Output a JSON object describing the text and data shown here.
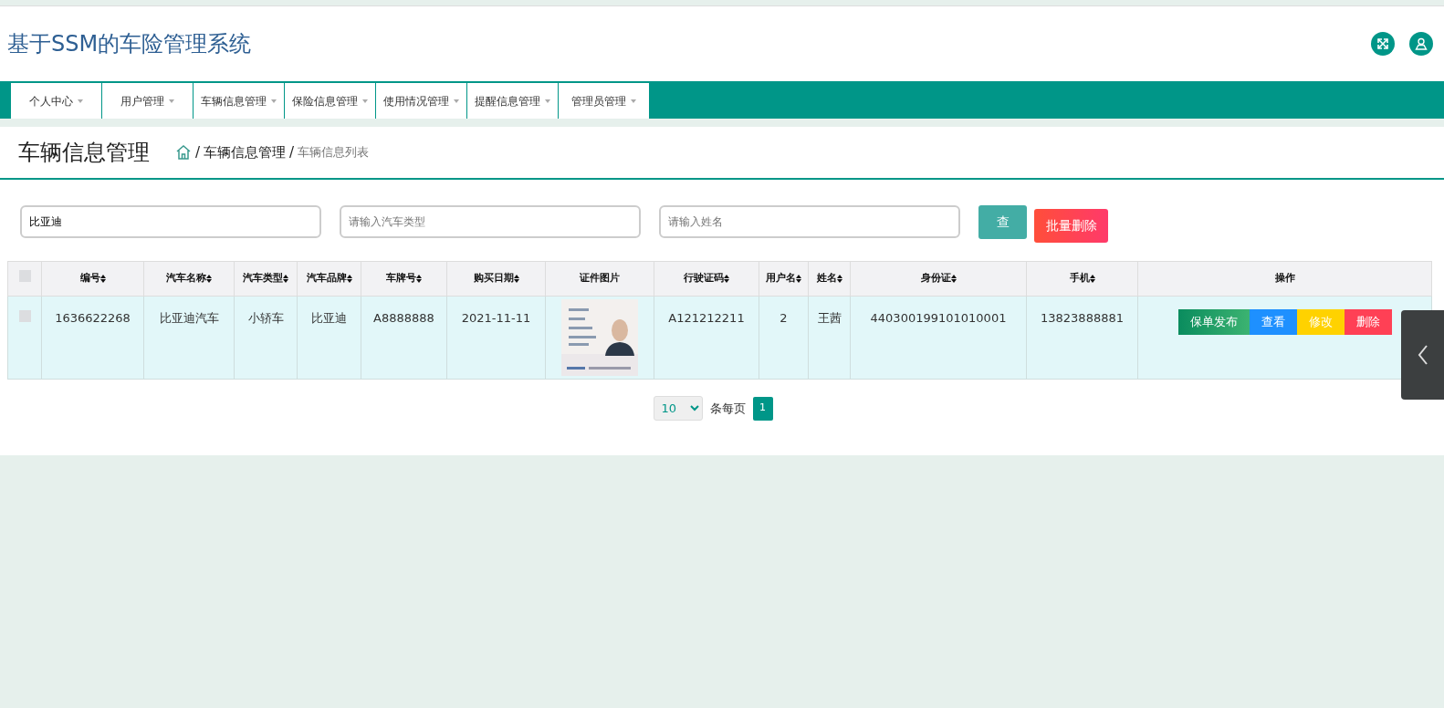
{
  "header": {
    "title": "基于SSM的车险管理系统"
  },
  "nav": [
    {
      "label": "个人中心",
      "dropdown": true
    },
    {
      "label": "用户管理",
      "dropdown": true
    },
    {
      "label": "车辆信息管理",
      "dropdown": true
    },
    {
      "label": "保险信息管理",
      "dropdown": true
    },
    {
      "label": "使用情况管理",
      "dropdown": true
    },
    {
      "label": "提醒信息管理",
      "dropdown": true
    },
    {
      "label": "管理员管理",
      "dropdown": true
    }
  ],
  "page": {
    "title": "车辆信息管理",
    "breadcrumb": [
      {
        "separator": "/",
        "label": "车辆信息管理",
        "current": false
      },
      {
        "separator": "/",
        "label": "车辆信息列表",
        "current": true
      }
    ]
  },
  "search": {
    "fields": [
      {
        "value": "比亚迪"
      },
      {
        "placeholder": "请输入汽车类型"
      },
      {
        "placeholder": "请输入姓名"
      }
    ],
    "query_button": "查",
    "batch_delete_button": "批量删除"
  },
  "table": {
    "select_all_checked": false,
    "columns": [
      {
        "label": "编号",
        "sortable": true
      },
      {
        "label": "汽车名称",
        "sortable": true
      },
      {
        "label": "汽车类型",
        "sortable": true
      },
      {
        "label": "汽车品牌",
        "sortable": true
      },
      {
        "label": "车牌号",
        "sortable": true
      },
      {
        "label": "购买日期",
        "sortable": true
      },
      {
        "label": "证件图片",
        "sortable": false
      },
      {
        "label": "行驶证码",
        "sortable": true
      },
      {
        "label": "用户名",
        "sortable": true
      },
      {
        "label": "姓名",
        "sortable": true
      },
      {
        "label": "身份证",
        "sortable": true
      },
      {
        "label": "手机",
        "sortable": true
      },
      {
        "label": "操作",
        "sortable": false
      }
    ],
    "rows": [
      {
        "checked": false,
        "cells": [
          "1636622268",
          "比亚迪汽车",
          "小轿车",
          "比亚迪",
          "A8888888",
          "2021-11-11",
          {
            "kind": "picture"
          },
          "A121212211",
          "2",
          "王茜",
          "440300199101010001",
          "13823888881"
        ],
        "actions": [
          {
            "label": "保单发布",
            "kind": "publish"
          },
          {
            "label": "查看",
            "kind": "view"
          },
          {
            "label": "修改",
            "kind": "edit"
          },
          {
            "label": "删除",
            "kind": "delete"
          }
        ]
      }
    ]
  },
  "pagination": {
    "page_size": "10",
    "per_page_label": "条每页",
    "pages": [
      {
        "label": "1",
        "selected": true
      }
    ]
  }
}
